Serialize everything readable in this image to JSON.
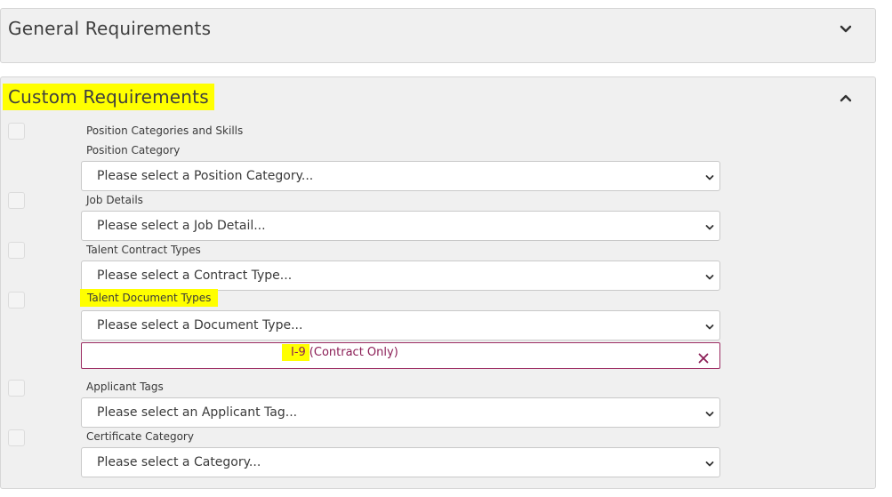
{
  "general": {
    "title": "General Requirements",
    "toggle_icon": "chevron-down-icon"
  },
  "custom": {
    "title": "Custom Requirements",
    "toggle_icon": "chevron-up-icon",
    "section_heading": "Position Categories and Skills",
    "fields": [
      {
        "label": "Position Category",
        "placeholder": "Please select a Position Category..."
      },
      {
        "label": "Job Details",
        "placeholder": "Please select a Job Detail..."
      },
      {
        "label": "Talent Contract Types",
        "placeholder": "Please select a Contract Type..."
      },
      {
        "label": "Talent Document Types",
        "placeholder": "Please select a Document Type..."
      },
      {
        "label": "Applicant Tags",
        "placeholder": "Please select an Applicant Tag..."
      },
      {
        "label": "Certificate Category",
        "placeholder": "Please select a Category..."
      }
    ],
    "selected_document": {
      "code": "I-9",
      "qualifier": "(Contract Only)",
      "remove_icon": "close-icon"
    }
  },
  "colors": {
    "panel_bg": "#f0f0f0",
    "highlight": "#ffff00",
    "tag_accent": "#8b1e56"
  }
}
